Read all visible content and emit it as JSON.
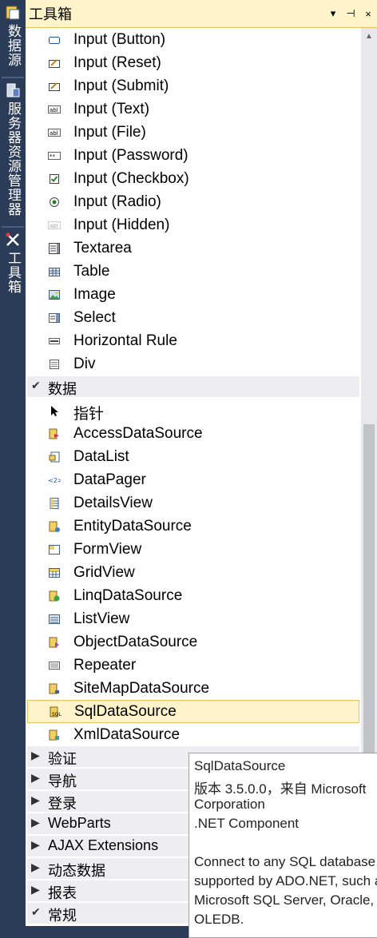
{
  "side_tabs": [
    {
      "label": "数据源",
      "icon": "database-icon"
    },
    {
      "label": "服务器资源管理器",
      "icon": "server-explorer-icon"
    },
    {
      "label": "工具箱",
      "icon": "toolbox-icon"
    }
  ],
  "toolbox": {
    "title": "工具箱",
    "buttons": {
      "dropdown": "▾",
      "pin": "⊣",
      "close": "×"
    }
  },
  "html_items": [
    {
      "label": "Input (Button)",
      "icon": "button-icon"
    },
    {
      "label": "Input (Reset)",
      "icon": "reset-icon"
    },
    {
      "label": "Input (Submit)",
      "icon": "submit-icon"
    },
    {
      "label": "Input (Text)",
      "icon": "textbox-icon"
    },
    {
      "label": "Input (File)",
      "icon": "file-input-icon"
    },
    {
      "label": "Input (Password)",
      "icon": "password-icon"
    },
    {
      "label": "Input (Checkbox)",
      "icon": "checkbox-icon"
    },
    {
      "label": "Input (Radio)",
      "icon": "radio-icon"
    },
    {
      "label": "Input (Hidden)",
      "icon": "hidden-input-icon"
    },
    {
      "label": "Textarea",
      "icon": "textarea-icon"
    },
    {
      "label": "Table",
      "icon": "table-icon"
    },
    {
      "label": "Image",
      "icon": "image-icon"
    },
    {
      "label": "Select",
      "icon": "select-icon"
    },
    {
      "label": "Horizontal Rule",
      "icon": "horizontal-rule-icon"
    },
    {
      "label": "Div",
      "icon": "div-icon"
    }
  ],
  "data_category": {
    "label": "数据",
    "expanded": true
  },
  "data_items": [
    {
      "label": "指针",
      "icon": "pointer-icon"
    },
    {
      "label": "AccessDataSource",
      "icon": "access-datasource-icon"
    },
    {
      "label": "DataList",
      "icon": "datalist-icon"
    },
    {
      "label": "DataPager",
      "icon": "datapager-icon"
    },
    {
      "label": "DetailsView",
      "icon": "detailsview-icon"
    },
    {
      "label": "EntityDataSource",
      "icon": "entity-datasource-icon"
    },
    {
      "label": "FormView",
      "icon": "formview-icon"
    },
    {
      "label": "GridView",
      "icon": "gridview-icon"
    },
    {
      "label": "LinqDataSource",
      "icon": "linq-datasource-icon"
    },
    {
      "label": "ListView",
      "icon": "listview-icon"
    },
    {
      "label": "ObjectDataSource",
      "icon": "object-datasource-icon"
    },
    {
      "label": "Repeater",
      "icon": "repeater-icon"
    },
    {
      "label": "SiteMapDataSource",
      "icon": "sitemap-datasource-icon"
    },
    {
      "label": "SqlDataSource",
      "icon": "sql-datasource-icon",
      "selected": true
    },
    {
      "label": "XmlDataSource",
      "icon": "xml-datasource-icon"
    }
  ],
  "collapsed_categories": [
    {
      "label": "验证"
    },
    {
      "label": "导航"
    },
    {
      "label": "登录"
    },
    {
      "label": "WebParts"
    },
    {
      "label": "AJAX Extensions"
    },
    {
      "label": "动态数据"
    },
    {
      "label": "报表"
    }
  ],
  "last_category": {
    "label": "常规",
    "expanded": true
  },
  "tooltip": {
    "name": "SqlDataSource",
    "version": "版本 3.5.0.0，来自 Microsoft",
    "vendor": "Corporation",
    "type": ".NET Component",
    "desc1": "Connect to any SQL database",
    "desc2": "supported by ADO.NET, such as",
    "desc3": "Microsoft SQL Server, Oracle, or",
    "desc4": "OLEDB."
  },
  "colors": {
    "selection": "#fff3c9",
    "selection_border": "#e5c365",
    "side_bar": "#2b3c59"
  }
}
